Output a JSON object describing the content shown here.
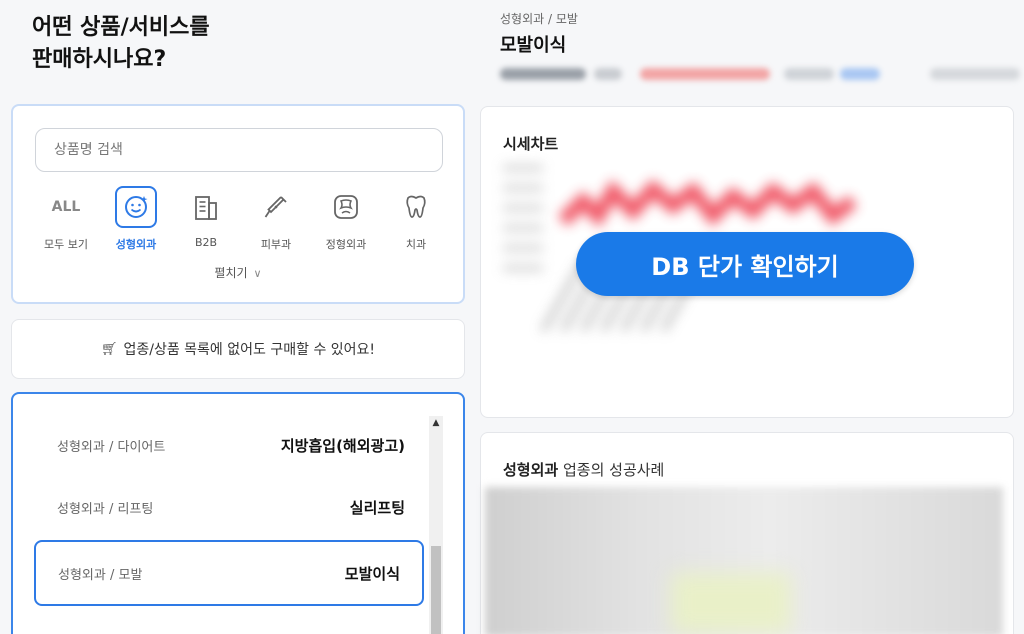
{
  "heading": {
    "line1": "어떤 상품/서비스를",
    "line2": "판매하시나요?"
  },
  "search": {
    "placeholder": "상품명 검색"
  },
  "categories": [
    {
      "icon": "all-icon",
      "icon_text": "ALL",
      "label": "모두 보기",
      "selected": false
    },
    {
      "icon": "smile-face-icon",
      "label": "성형외과",
      "selected": true
    },
    {
      "icon": "building-icon",
      "label": "B2B",
      "selected": false
    },
    {
      "icon": "syringe-icon",
      "label": "피부과",
      "selected": false
    },
    {
      "icon": "bone-icon",
      "label": "정형외과",
      "selected": false
    },
    {
      "icon": "tooth-icon",
      "label": "치과",
      "selected": false
    }
  ],
  "expand_label": "펼치기",
  "notice": {
    "icon": "cart-icon",
    "text": "업종/상품 목록에 없어도 구매할 수 있어요!"
  },
  "product_list": [
    {
      "category": "성형외과 / 다이어트",
      "name": "지방흡입(해외광고)",
      "selected": false
    },
    {
      "category": "성형외과 / 리프팅",
      "name": "실리프팅",
      "selected": false
    },
    {
      "category": "성형외과 / 모발",
      "name": "모발이식",
      "selected": true
    }
  ],
  "detail": {
    "breadcrumb": "성형외과 / 모발",
    "title": "모발이식"
  },
  "chart_section": {
    "title": "시세차트",
    "button_label": "DB 단가 확인하기"
  },
  "cases_section": {
    "title_bold": "성형외과",
    "title_rest": " 업종의 성공사례"
  },
  "colors": {
    "accent": "#2e7ae6",
    "button": "#1a7ae8"
  }
}
